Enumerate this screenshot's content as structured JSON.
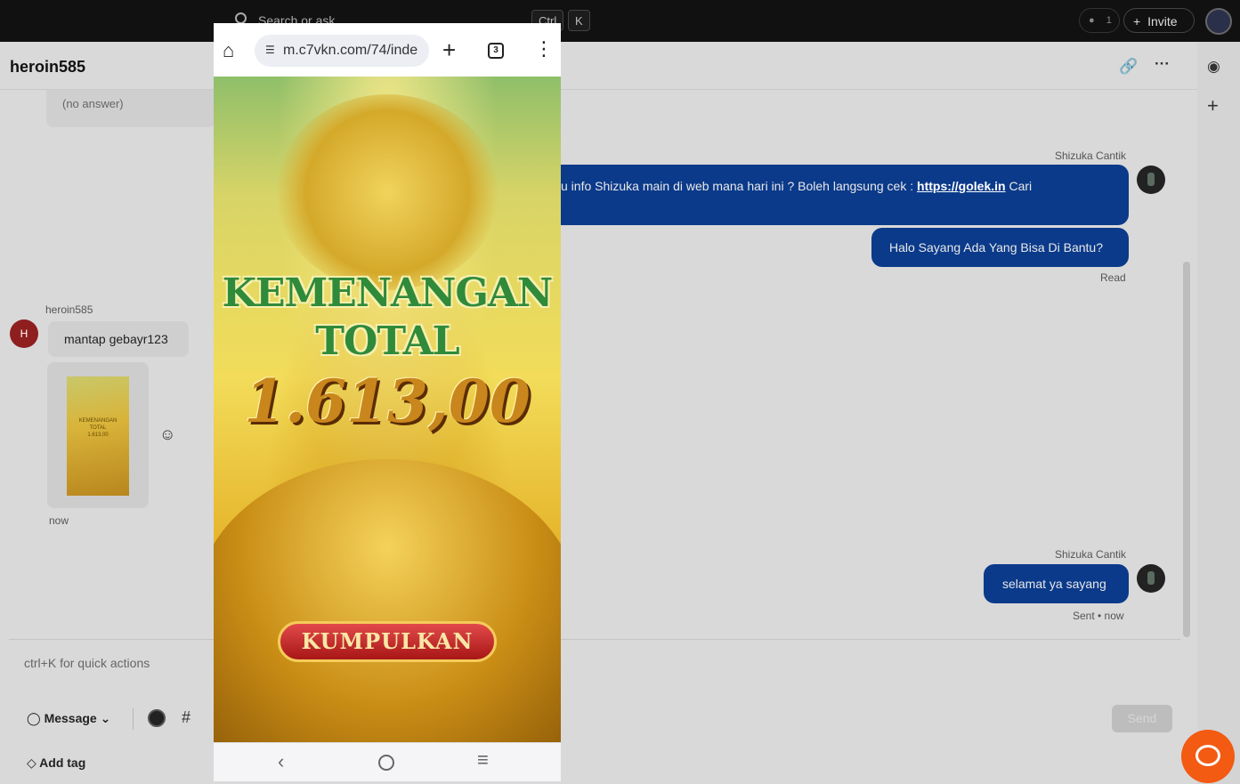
{
  "topbar": {
    "search_placeholder": "Search or ask",
    "shortcut_ctrl": "Ctrl",
    "shortcut_k": "K",
    "counter": "1",
    "invite_label": "Invite"
  },
  "conversation": {
    "title": "heroin585",
    "no_answer": "(no answer)",
    "incoming": {
      "sender": "heroin585",
      "avatar_letter": "H",
      "text": "mantap gebayr123",
      "time": "now"
    },
    "outgoing": [
      {
        "sender": "Shizuka Cantik",
        "text_before": "u info Shizuka main di web mana hari ini ? Boleh langsung cek : ",
        "link": "https://golek.in",
        "text_after": " Cari"
      },
      {
        "text": "Halo Sayang Ada Yang Bisa Di Bantu?",
        "status": "Read"
      },
      {
        "sender": "Shizuka Cantik",
        "text": "selamat ya sayang",
        "status": "Sent • now"
      }
    ]
  },
  "composer": {
    "placeholder": "ctrl+K for quick actions",
    "message_type": "Message",
    "send_label": "Send",
    "add_tag": "Add tag"
  },
  "phone": {
    "url": "m.c7vkn.com/74/inde",
    "tab_count": "3",
    "game": {
      "title_line1": "KEMENANGAN",
      "title_line2": "TOTAL",
      "amount": "1.613,00",
      "collect_button": "KUMPULKAN"
    }
  },
  "icons": {
    "search": "search-icon",
    "link": "link-icon",
    "more": "more-icon",
    "user": "user-circle-icon",
    "add": "plus-icon",
    "emoji": "emoji-add-icon",
    "tag": "tag-icon",
    "chat": "chat-bubble-icon"
  },
  "colors": {
    "outgoing_bubble": "#0b3a8a",
    "chat_fab": "#f35a12",
    "avatar_h": "#8f1e1e"
  }
}
